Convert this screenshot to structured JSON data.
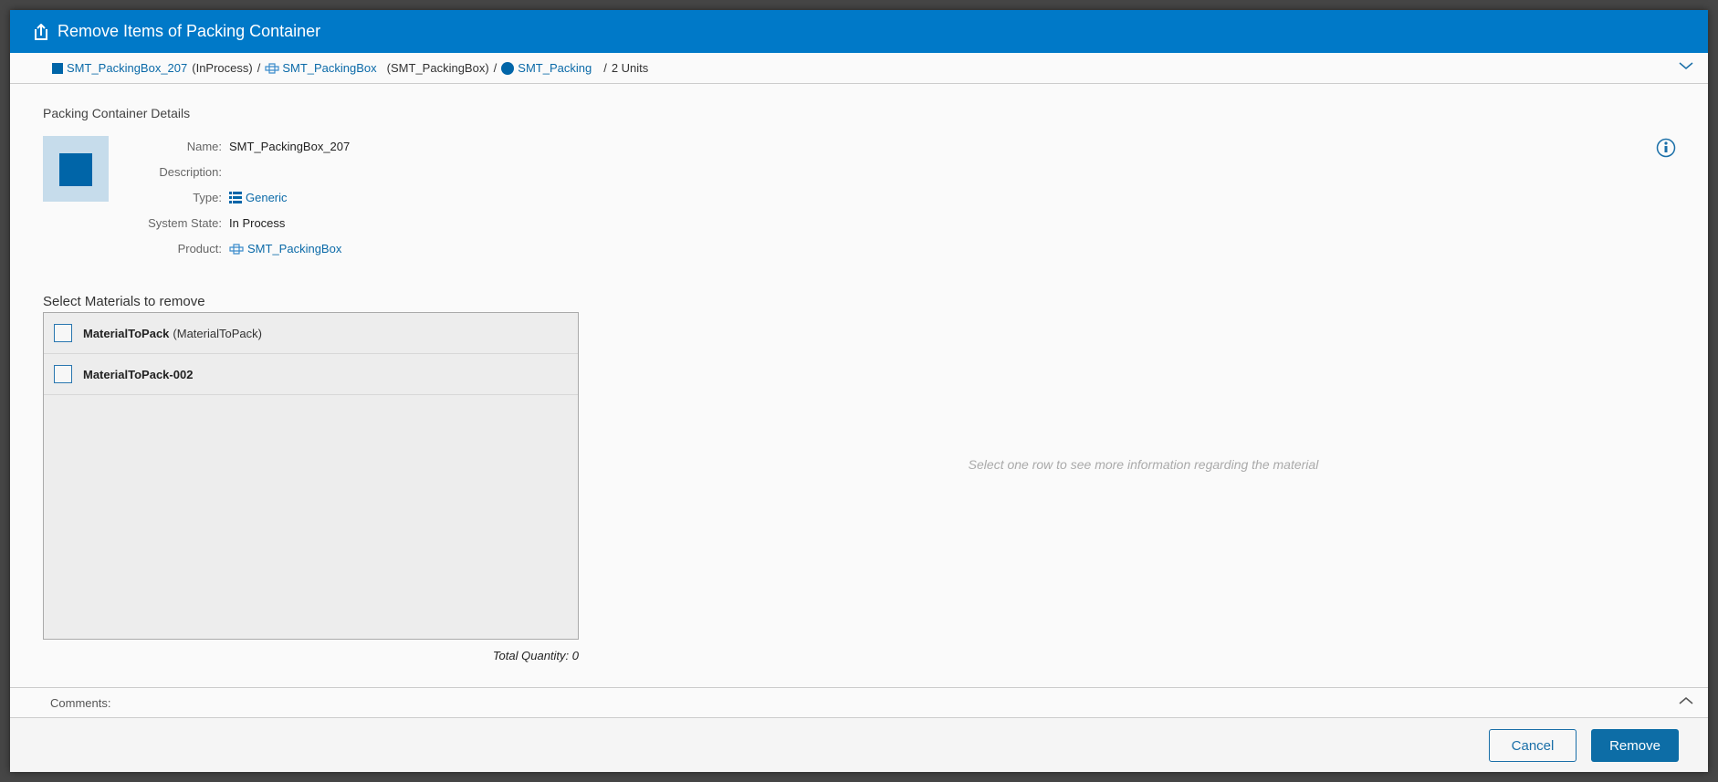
{
  "dialog": {
    "title": "Remove Items of Packing Container"
  },
  "breadcrumb": {
    "container": "SMT_PackingBox_207",
    "container_state": "(InProcess)",
    "product": "SMT_PackingBox",
    "product_paren": "(SMT_PackingBox)",
    "step": "SMT_Packing",
    "units": "2 Units",
    "sep": "/"
  },
  "details": {
    "title": "Packing Container Details",
    "fields": [
      {
        "label": "Name:",
        "value": "SMT_PackingBox_207"
      },
      {
        "label": "Description:",
        "value": ""
      },
      {
        "label": "Type:",
        "value": "Generic"
      },
      {
        "label": "System State:",
        "value": "In Process"
      },
      {
        "label": "Product:",
        "value": "SMT_PackingBox"
      }
    ]
  },
  "materials": {
    "title": "Select Materials to remove",
    "items": [
      {
        "name": "MaterialToPack",
        "sub": "(MaterialToPack)"
      },
      {
        "name": "MaterialToPack-002",
        "sub": ""
      }
    ],
    "total": "Total Quantity: 0"
  },
  "detail_placeholder": "Select one row to see more information regarding the material",
  "comments": {
    "label": "Comments:"
  },
  "footer": {
    "cancel": "Cancel",
    "remove": "Remove"
  },
  "colors": {
    "accent": "#0079c8",
    "button": "#0d6da6"
  }
}
